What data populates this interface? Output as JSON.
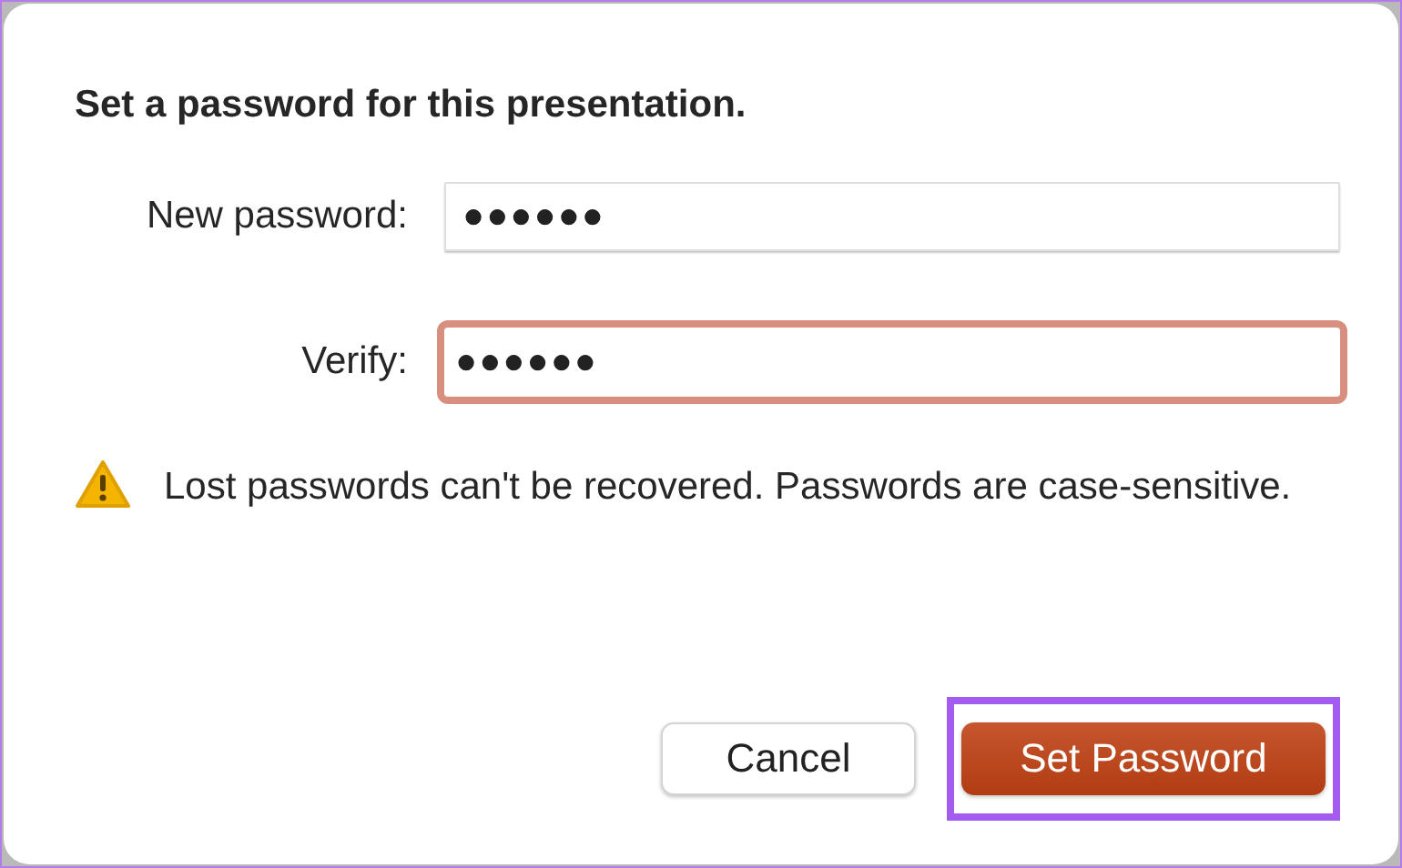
{
  "dialog": {
    "title": "Set a password for this presentation.",
    "fields": [
      {
        "label": "New password:",
        "value": "●●●●●●",
        "focused": false
      },
      {
        "label": "Verify:",
        "value": "●●●●●●",
        "focused": true
      }
    ],
    "warning": "Lost passwords can't be recovered. Passwords are case-sensitive.",
    "buttons": [
      {
        "label": "Cancel",
        "kind": "secondary",
        "highlighted": false
      },
      {
        "label": "Set Password",
        "kind": "primary",
        "highlighted": true
      }
    ]
  }
}
